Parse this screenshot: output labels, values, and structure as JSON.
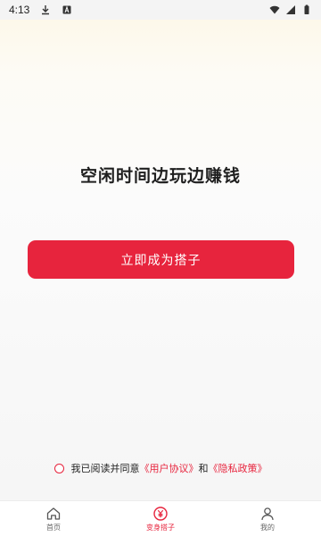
{
  "status_bar": {
    "time": "4:13",
    "icons": [
      "download-icon",
      "a-icon",
      "wifi-icon",
      "signal-icon",
      "battery-icon"
    ]
  },
  "main": {
    "headline": "空闲时间边玩边赚钱",
    "cta_label": "立即成为搭子"
  },
  "agreement": {
    "prefix": "我已阅读并同意",
    "user_agreement": "《用户协议》",
    "and": "和",
    "privacy_policy": "《隐私政策》",
    "checked": false
  },
  "tabbar": {
    "tabs": [
      {
        "label": "首页",
        "icon": "home-icon",
        "active": false
      },
      {
        "label": "变身搭子",
        "icon": "yen-icon",
        "active": true
      },
      {
        "label": "我的",
        "icon": "user-icon",
        "active": false
      }
    ]
  },
  "colors": {
    "accent": "#e7243d",
    "text": "#1f1f1f"
  }
}
